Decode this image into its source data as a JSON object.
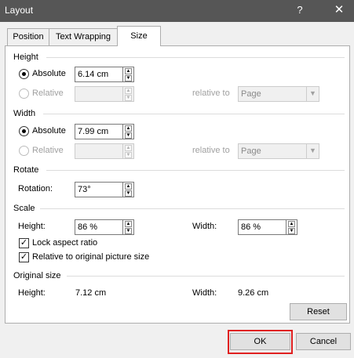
{
  "window": {
    "title": "Layout",
    "help": "?",
    "close": "✕"
  },
  "tabs": [
    {
      "label": "Position"
    },
    {
      "label": "Text Wrapping"
    },
    {
      "label": "Size"
    }
  ],
  "height_section": {
    "title": "Height",
    "absolute_label": "Absolute",
    "absolute_value": "6.14 cm",
    "relative_label": "Relative",
    "relative_value": "",
    "relative_to_label": "relative to",
    "relative_to_value": "Page"
  },
  "width_section": {
    "title": "Width",
    "absolute_label": "Absolute",
    "absolute_value": "7.99 cm",
    "relative_label": "Relative",
    "relative_value": "",
    "relative_to_label": "relative to",
    "relative_to_value": "Page"
  },
  "rotate_section": {
    "title": "Rotate",
    "rotation_label": "Rotation:",
    "rotation_value": "73°"
  },
  "scale_section": {
    "title": "Scale",
    "height_label": "Height:",
    "height_value": "86 %",
    "width_label": "Width:",
    "width_value": "86 %",
    "lock_aspect_label": "Lock aspect ratio",
    "relative_original_label": "Relative to original picture size"
  },
  "original_size": {
    "title": "Original size",
    "height_label": "Height:",
    "height_value": "7.12 cm",
    "width_label": "Width:",
    "width_value": "9.26 cm"
  },
  "buttons": {
    "reset": "Reset",
    "ok": "OK",
    "cancel": "Cancel"
  },
  "colors": {
    "titlebar": "#565656",
    "highlight": "#e02020"
  }
}
